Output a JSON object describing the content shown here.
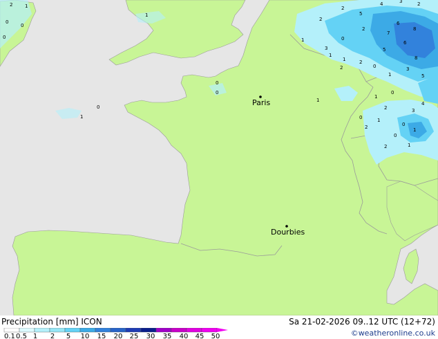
{
  "map": {
    "colors": {
      "sea": "#e6e6e6",
      "land": "#c8f596",
      "border": "#9a9a9a",
      "precip_light": "#b4f0fa",
      "precip_mid": "#64d2f5",
      "precip_heavy": "#3caae6",
      "precip_strong": "#3282dc"
    },
    "cities": [
      {
        "name": "Paris"
      },
      {
        "name": "Dourbies"
      }
    ],
    "precip_values": [
      "2",
      "1",
      "0",
      "0",
      "0",
      "1",
      "0",
      "1",
      "0",
      "0",
      "1",
      "1",
      "2",
      "5",
      "4",
      "3",
      "2",
      "6",
      "8",
      "7",
      "6",
      "3",
      "8",
      "5",
      "2",
      "1",
      "0",
      "1",
      "3",
      "5",
      "2",
      "0",
      "1",
      "2",
      "3",
      "4",
      "0",
      "1",
      "0",
      "1",
      "0",
      "2",
      "1",
      "2",
      "1",
      "2",
      "0",
      "2"
    ]
  },
  "footer": {
    "title": "Precipitation [mm]  ICON",
    "datetime": "Sa 21-02-2026 09..12 UTC (12+72)",
    "credit": "©weatheronline.co.uk",
    "legend": {
      "labels": [
        "0.1",
        "0.5",
        "1",
        "2",
        "5",
        "10",
        "15",
        "20",
        "25",
        "30",
        "35",
        "40",
        "45",
        "50"
      ],
      "colors": [
        "#ffffff",
        "#dcfaff",
        "#b4f0fa",
        "#96e6f5",
        "#64d2f5",
        "#3caae6",
        "#3282dc",
        "#2864c8",
        "#1e3cb4",
        "#0a1e8c",
        "#a000c8",
        "#c800c8",
        "#e100e1",
        "#f000f0"
      ]
    }
  }
}
